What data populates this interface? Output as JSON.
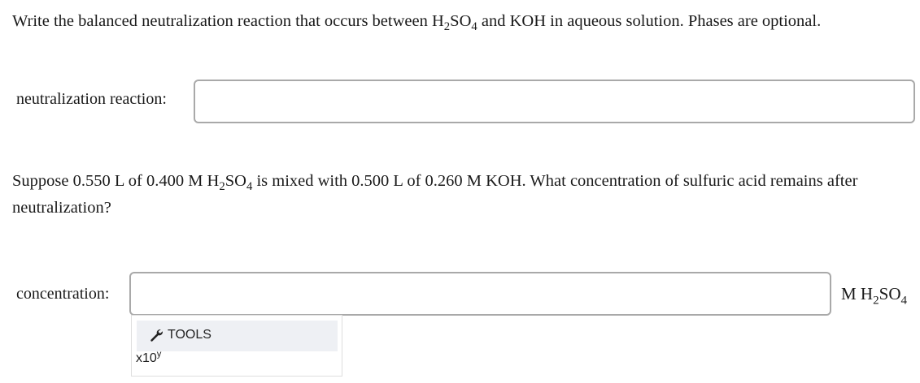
{
  "question1": {
    "part1": "Write the balanced neutralization reaction that occurs between H",
    "sub1": "2",
    "part2": "SO",
    "sub2": "4",
    "part3": " and KOH in aqueous solution. Phases are optional."
  },
  "field1": {
    "label": "neutralization reaction:",
    "value": ""
  },
  "question2": {
    "part1": "Suppose 0.550 L of 0.400 M H",
    "sub1": "2",
    "part2": "SO",
    "sub2": "4",
    "part3": " is mixed with 0.500 L of 0.260 M KOH. What concentration of sulfuric acid remains after neutralization?"
  },
  "field2": {
    "label": "concentration:",
    "value": "",
    "unit_prefix": "M H",
    "unit_sub1": "2",
    "unit_mid": "SO",
    "unit_sub2": "4"
  },
  "toolbox": {
    "tools_label": "TOOLS",
    "x10_base": "x10",
    "x10_exp": "y",
    "icon": "wrench-icon"
  }
}
